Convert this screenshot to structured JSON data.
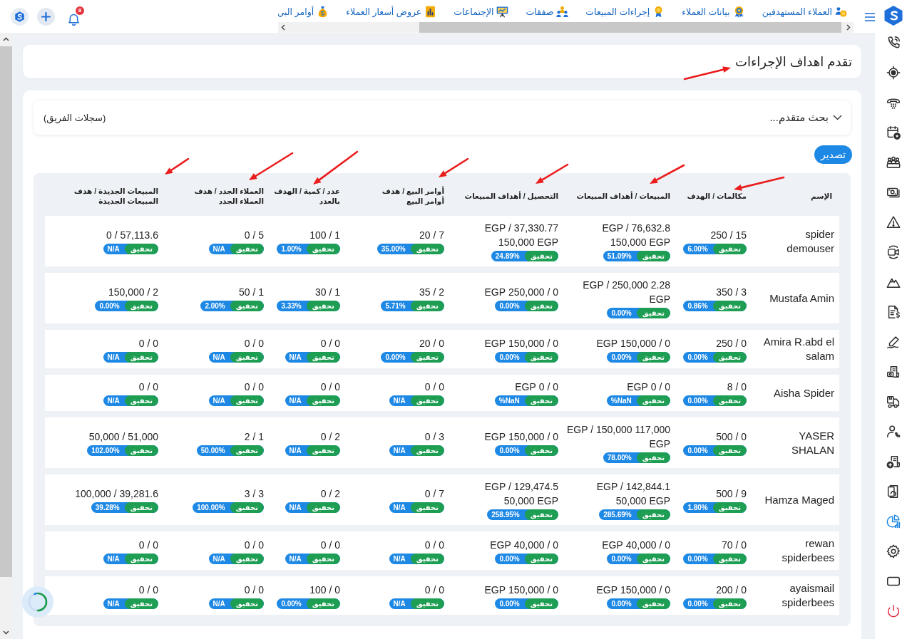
{
  "topbar": {
    "notification_count": "8",
    "tabs": [
      {
        "label": "العملاء المستهدفين"
      },
      {
        "label": "بيانات العملاء"
      },
      {
        "label": "إجراءات المبيعات"
      },
      {
        "label": "صفقات"
      },
      {
        "label": "الإجتماعات"
      },
      {
        "label": "عروض أسعار العملاء"
      },
      {
        "label": "أوامر البي"
      }
    ]
  },
  "sidebar": {
    "items": [
      {
        "selected": false
      },
      {
        "selected": false
      },
      {
        "selected": false
      },
      {
        "selected": false
      },
      {
        "selected": false
      },
      {
        "selected": false
      },
      {
        "selected": false
      },
      {
        "selected": false
      },
      {
        "selected": false
      },
      {
        "selected": false
      },
      {
        "selected": false
      },
      {
        "selected": false
      },
      {
        "selected": false
      },
      {
        "selected": false
      },
      {
        "selected": false
      },
      {
        "selected": false
      },
      {
        "selected": true
      },
      {
        "selected": false
      },
      {
        "selected": false
      },
      {
        "selected": false
      }
    ]
  },
  "page_title": {
    "text": "تقدم اهداف الإجراءات",
    "annotated": true
  },
  "filter": {
    "label": "بحث متقدم...",
    "expanded": false,
    "scope": "(سجلات الفريق)"
  },
  "export_button": {
    "label": "تصدير"
  },
  "table": {
    "columns": [
      {
        "label": "الإسم",
        "annotated": false
      },
      {
        "label": "مكالمات / الهدف",
        "annotated": true
      },
      {
        "label": "المبيعات / أهداف المبيعات",
        "annotated": true
      },
      {
        "label": "التحصيل / أهداف المبيعات",
        "annotated": true
      },
      {
        "label": "أوامر البيع / هدف أوامر البيع",
        "annotated": true
      },
      {
        "label": "عدد / كمية / الهدف بالعدد",
        "annotated": true
      },
      {
        "label": "العملاء الجدد / هدف العملاء الجدد",
        "annotated": true
      },
      {
        "label": "المبيعات الجديدة / هدف المبيعات الجديدة",
        "annotated": true
      }
    ],
    "rows": [
      {
        "cells": [
          {
            "kind": "name",
            "text": "spider demouser"
          },
          {
            "kind": "ratio",
            "value": "15 / 250",
            "label": "تحقيق",
            "percent": "6.00%"
          },
          {
            "kind": "ratio",
            "value": "76,632.8 EGP / 150,000 EGP",
            "label": "تحقيق",
            "percent": "51.09%"
          },
          {
            "kind": "ratio",
            "value": "37,330.77 EGP / 150,000 EGP",
            "label": "تحقيق",
            "percent": "24.89%"
          },
          {
            "kind": "ratio",
            "value": "7 / 20",
            "label": "تحقيق",
            "percent": "35.00%"
          },
          {
            "kind": "ratio",
            "value": "1 / 100",
            "label": "تحقيق",
            "percent": "1.00%"
          },
          {
            "kind": "ratio",
            "value": "5 / 0",
            "label": "تحقيق",
            "percent": "N/A"
          },
          {
            "kind": "ratio",
            "value": "57,113.6 / 0",
            "label": "تحقيق",
            "percent": "N/A"
          }
        ]
      },
      {
        "cells": [
          {
            "kind": "name",
            "text": "Mustafa Amin"
          },
          {
            "kind": "ratio",
            "value": "3 / 350",
            "label": "تحقيق",
            "percent": "0.86%"
          },
          {
            "kind": "ratio",
            "value": "2.28 EGP / 250,000 EGP",
            "label": "تحقيق",
            "percent": "0.00%"
          },
          {
            "kind": "ratio",
            "value": "0 / 250,000 EGP",
            "label": "تحقيق",
            "percent": "0.00%"
          },
          {
            "kind": "ratio",
            "value": "2 / 35",
            "label": "تحقيق",
            "percent": "5.71%"
          },
          {
            "kind": "ratio",
            "value": "1 / 30",
            "label": "تحقيق",
            "percent": "3.33%"
          },
          {
            "kind": "ratio",
            "value": "1 / 50",
            "label": "تحقيق",
            "percent": "2.00%"
          },
          {
            "kind": "ratio",
            "value": "2 / 150,000",
            "label": "تحقيق",
            "percent": "0.00%"
          }
        ]
      },
      {
        "cells": [
          {
            "kind": "name",
            "text": "Amira R.abd el salam"
          },
          {
            "kind": "ratio",
            "value": "0 / 250",
            "label": "تحقيق",
            "percent": "0.00%"
          },
          {
            "kind": "ratio",
            "value": "0 / 150,000 EGP",
            "label": "تحقيق",
            "percent": "0.00%"
          },
          {
            "kind": "ratio",
            "value": "0 / 150,000 EGP",
            "label": "تحقيق",
            "percent": "0.00%"
          },
          {
            "kind": "ratio",
            "value": "0 / 20",
            "label": "تحقيق",
            "percent": "0.00%"
          },
          {
            "kind": "ratio",
            "value": "0 / 0",
            "label": "تحقيق",
            "percent": "N/A"
          },
          {
            "kind": "ratio",
            "value": "0 / 0",
            "label": "تحقيق",
            "percent": "N/A"
          },
          {
            "kind": "ratio",
            "value": "0 / 0",
            "label": "تحقيق",
            "percent": "N/A"
          }
        ]
      },
      {
        "cells": [
          {
            "kind": "name",
            "text": "Aisha Spider"
          },
          {
            "kind": "ratio",
            "value": "0 / 8",
            "label": "تحقيق",
            "percent": "0.00%"
          },
          {
            "kind": "ratio",
            "value": "0 / 0 EGP",
            "label": "تحقيق",
            "percent": "NaN%"
          },
          {
            "kind": "ratio",
            "value": "0 / 0 EGP",
            "label": "تحقيق",
            "percent": "NaN%"
          },
          {
            "kind": "ratio",
            "value": "0 / 0",
            "label": "تحقيق",
            "percent": "N/A"
          },
          {
            "kind": "ratio",
            "value": "0 / 0",
            "label": "تحقيق",
            "percent": "N/A"
          },
          {
            "kind": "ratio",
            "value": "0 / 0",
            "label": "تحقيق",
            "percent": "N/A"
          },
          {
            "kind": "ratio",
            "value": "0 / 0",
            "label": "تحقيق",
            "percent": "N/A"
          }
        ]
      },
      {
        "cells": [
          {
            "kind": "name",
            "text": "YASER SHALAN"
          },
          {
            "kind": "ratio",
            "value": "0 / 500",
            "label": "تحقيق",
            "percent": "0.00%"
          },
          {
            "kind": "ratio",
            "value": "117,000 EGP / 150,000 EGP",
            "label": "تحقيق",
            "percent": "78.00%"
          },
          {
            "kind": "ratio",
            "value": "0 / 150,000 EGP",
            "label": "تحقيق",
            "percent": "0.00%"
          },
          {
            "kind": "ratio",
            "value": "3 / 0",
            "label": "تحقيق",
            "percent": "N/A"
          },
          {
            "kind": "ratio",
            "value": "2 / 0",
            "label": "تحقيق",
            "percent": "N/A"
          },
          {
            "kind": "ratio",
            "value": "1 / 2",
            "label": "تحقيق",
            "percent": "50.00%"
          },
          {
            "kind": "ratio",
            "value": "51,000 / 50,000",
            "label": "تحقيق",
            "percent": "102.00%"
          }
        ]
      },
      {
        "cells": [
          {
            "kind": "name",
            "text": "Hamza Maged"
          },
          {
            "kind": "ratio",
            "value": "9 / 500",
            "label": "تحقيق",
            "percent": "1.80%"
          },
          {
            "kind": "ratio",
            "value": "142,844.1 EGP / 50,000 EGP",
            "label": "تحقيق",
            "percent": "285.69%"
          },
          {
            "kind": "ratio",
            "value": "129,474.5 EGP / 50,000 EGP",
            "label": "تحقيق",
            "percent": "258.95%"
          },
          {
            "kind": "ratio",
            "value": "7 / 0",
            "label": "تحقيق",
            "percent": "N/A"
          },
          {
            "kind": "ratio",
            "value": "2 / 0",
            "label": "تحقيق",
            "percent": "N/A"
          },
          {
            "kind": "ratio",
            "value": "3 / 3",
            "label": "تحقيق",
            "percent": "100.00%"
          },
          {
            "kind": "ratio",
            "value": "39,281.6 / 100,000",
            "label": "تحقيق",
            "percent": "39.28%"
          }
        ]
      },
      {
        "cells": [
          {
            "kind": "name",
            "text": "rewan spiderbees"
          },
          {
            "kind": "ratio",
            "value": "0 / 70",
            "label": "تحقيق",
            "percent": "0.00%"
          },
          {
            "kind": "ratio",
            "value": "0 / 40,000 EGP",
            "label": "تحقيق",
            "percent": "0.00%"
          },
          {
            "kind": "ratio",
            "value": "0 / 40,000 EGP",
            "label": "تحقيق",
            "percent": "0.00%"
          },
          {
            "kind": "ratio",
            "value": "0 / 0",
            "label": "تحقيق",
            "percent": "N/A"
          },
          {
            "kind": "ratio",
            "value": "0 / 0",
            "label": "تحقيق",
            "percent": "N/A"
          },
          {
            "kind": "ratio",
            "value": "0 / 0",
            "label": "تحقيق",
            "percent": "N/A"
          },
          {
            "kind": "ratio",
            "value": "0 / 0",
            "label": "تحقيق",
            "percent": "N/A"
          }
        ]
      },
      {
        "cells": [
          {
            "kind": "name",
            "text": "ayaismail spiderbees"
          },
          {
            "kind": "ratio",
            "value": "0 / 200",
            "label": "تحقيق",
            "percent": "0.00%"
          },
          {
            "kind": "ratio",
            "value": "0 / 150,000 EGP",
            "label": "تحقيق",
            "percent": "0.00%"
          },
          {
            "kind": "ratio",
            "value": "0 / 150,000 EGP",
            "label": "تحقيق",
            "percent": "0.00%"
          },
          {
            "kind": "ratio",
            "value": "0 / 0",
            "label": "تحقيق",
            "percent": "N/A"
          },
          {
            "kind": "ratio",
            "value": "0 / 100",
            "label": "تحقيق",
            "percent": "0.00%"
          },
          {
            "kind": "ratio",
            "value": "0 / 0",
            "label": "تحقيق",
            "percent": "N/A"
          },
          {
            "kind": "ratio",
            "value": "0 / 0",
            "label": "تحقيق",
            "percent": "N/A"
          }
        ]
      }
    ]
  }
}
